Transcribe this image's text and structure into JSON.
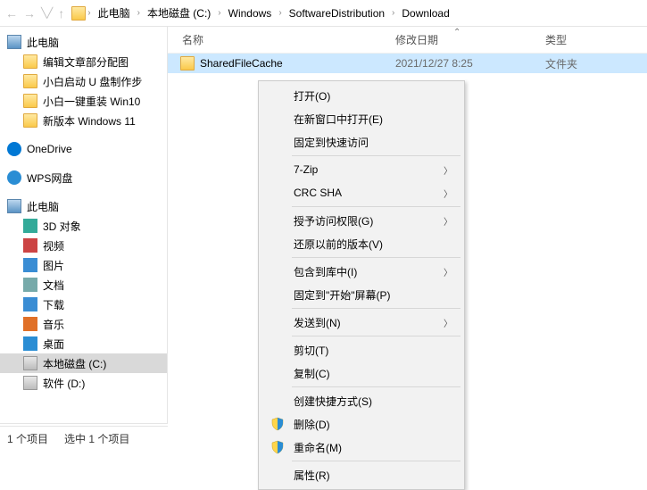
{
  "breadcrumb": {
    "items": [
      "此电脑",
      "本地磁盘 (C:)",
      "Windows",
      "SoftwareDistribution",
      "Download"
    ]
  },
  "sidebar": {
    "quick": {
      "root": "此电脑",
      "items": [
        "编辑文章部分配图",
        "小白启动 U 盘制作步",
        "小白一键重装 Win10",
        "新版本 Windows 11"
      ]
    },
    "onedrive": "OneDrive",
    "wps": "WPS网盘",
    "thispc": {
      "root": "此电脑",
      "items": [
        "3D 对象",
        "视频",
        "图片",
        "文档",
        "下载",
        "音乐",
        "桌面",
        "本地磁盘 (C:)",
        "软件 (D:)"
      ]
    }
  },
  "columns": {
    "name": "名称",
    "date": "修改日期",
    "type": "类型"
  },
  "rows": [
    {
      "name": "SharedFileCache",
      "date": "2021/12/27 8:25",
      "type": "文件夹"
    }
  ],
  "status": {
    "count": "1 个项目",
    "selected": "选中 1 个项目"
  },
  "context_menu": {
    "groups": [
      [
        {
          "label": "打开(O)"
        },
        {
          "label": "在新窗口中打开(E)"
        },
        {
          "label": "固定到快速访问"
        }
      ],
      [
        {
          "label": "7-Zip",
          "submenu": true
        },
        {
          "label": "CRC SHA",
          "submenu": true
        }
      ],
      [
        {
          "label": "授予访问权限(G)",
          "submenu": true
        },
        {
          "label": "还原以前的版本(V)"
        }
      ],
      [
        {
          "label": "包含到库中(I)",
          "submenu": true
        },
        {
          "label": "固定到\"开始\"屏幕(P)"
        }
      ],
      [
        {
          "label": "发送到(N)",
          "submenu": true
        }
      ],
      [
        {
          "label": "剪切(T)"
        },
        {
          "label": "复制(C)"
        }
      ],
      [
        {
          "label": "创建快捷方式(S)"
        },
        {
          "label": "删除(D)",
          "shield": true
        },
        {
          "label": "重命名(M)",
          "shield": true
        }
      ],
      [
        {
          "label": "属性(R)"
        }
      ]
    ]
  }
}
